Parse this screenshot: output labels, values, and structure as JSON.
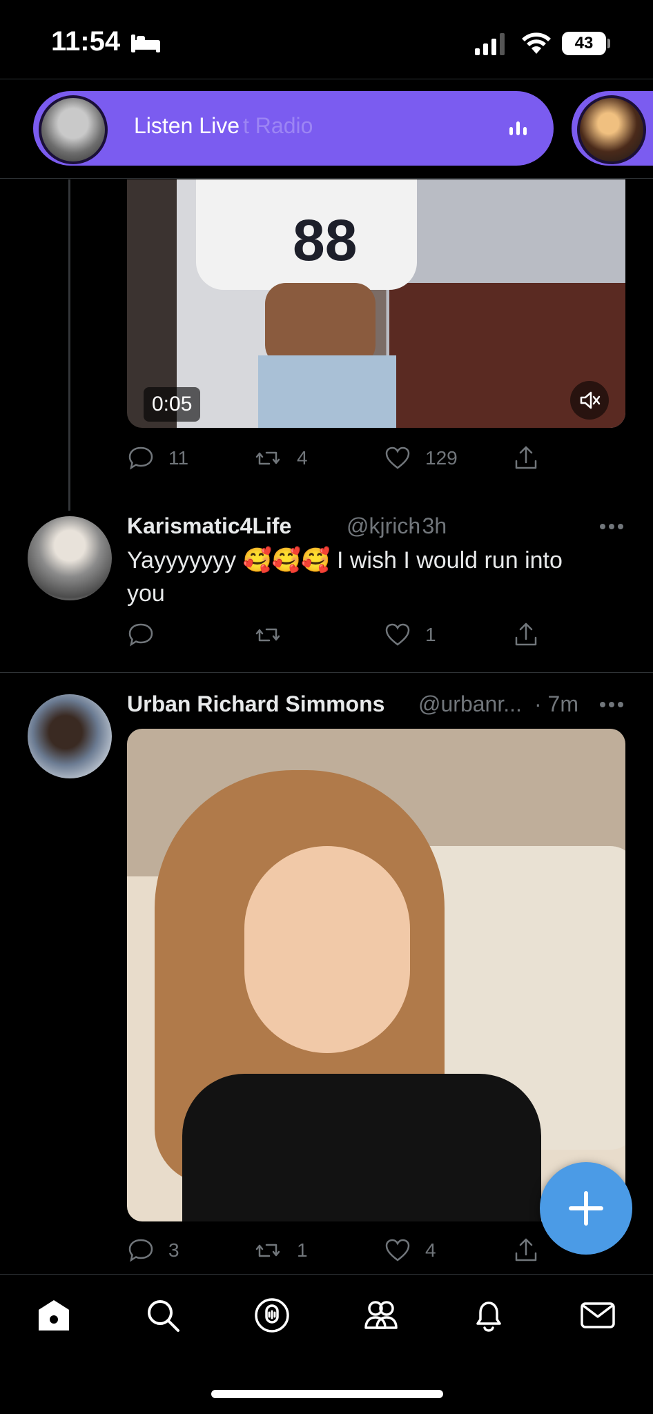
{
  "status_bar": {
    "time": "11:54",
    "battery": "43"
  },
  "live_bar": {
    "label": "Listen Live",
    "faded_text": "t Radio"
  },
  "video_post": {
    "timer": "0:05",
    "stats": {
      "replies": "11",
      "retweets": "4",
      "likes": "129"
    },
    "jersey_number": "88"
  },
  "reply_tweet": {
    "display_name": "Karismatic4Life",
    "handle": "@kjrich",
    "time": "· 3h",
    "text_line1": "Yayyyyyyy 🥰🥰🥰 I wish I would run into",
    "text_line2": "you",
    "stats": {
      "replies": "",
      "retweets": "",
      "likes": "1"
    }
  },
  "photo_tweet": {
    "display_name": "Urban Richard Simmons",
    "handle": "@urbanr...",
    "time": "· 7m",
    "stats": {
      "replies": "3",
      "retweets": "1",
      "likes": "4"
    }
  },
  "bottom_nav": {
    "items": [
      "home-icon",
      "search-icon",
      "spaces-icon",
      "communities-icon",
      "notifications-icon",
      "messages-icon"
    ]
  },
  "colors": {
    "accent": "#7b5cf0",
    "fab": "#4b9be6",
    "muted": "#71767b"
  }
}
